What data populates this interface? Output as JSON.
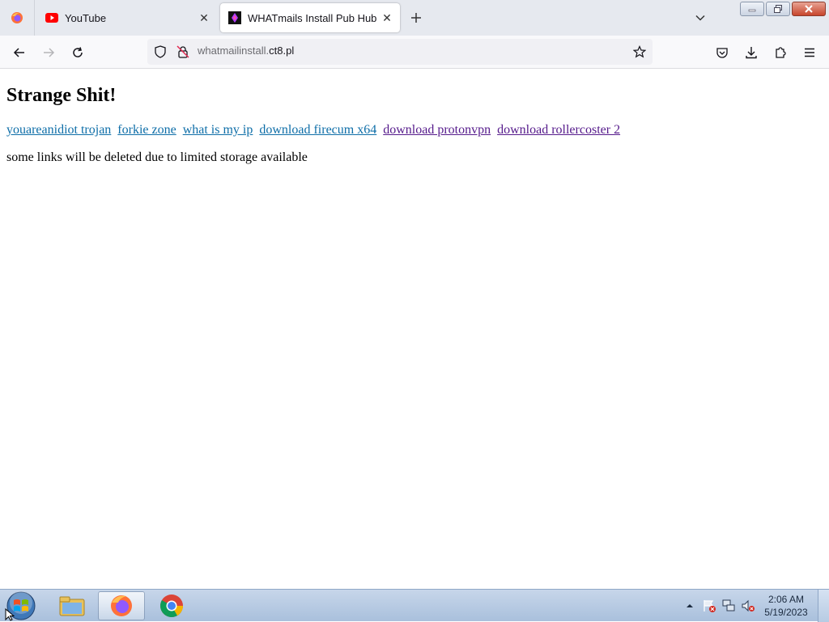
{
  "browser": {
    "tabs": [
      {
        "label": "YouTube",
        "active": false
      },
      {
        "label": "WHATmails Install Pub Hub",
        "active": true
      }
    ],
    "url": {
      "subdomain": "whatmailinstall.",
      "domain": "ct8.pl"
    }
  },
  "page": {
    "heading": "Strange Shit!",
    "links": [
      {
        "label": "youareanidiot trojan",
        "visited": false
      },
      {
        "label": "forkie zone",
        "visited": false
      },
      {
        "label": "what is my ip",
        "visited": false
      },
      {
        "label": "download firecum x64",
        "visited": false
      },
      {
        "label": "download protonvpn",
        "visited": true
      },
      {
        "label": "download rollercoster 2",
        "visited": true
      }
    ],
    "notice": "some links will be deleted due to limited storage available"
  },
  "taskbar": {
    "apps": [
      "explorer-icon",
      "firefox-icon",
      "chrome-icon"
    ],
    "clock": {
      "time": "2:06 AM",
      "date": "5/19/2023"
    }
  },
  "colors": {
    "link": "#0e6ea8",
    "visited_link": "#551a8b",
    "youtube_red": "#ff0000"
  }
}
